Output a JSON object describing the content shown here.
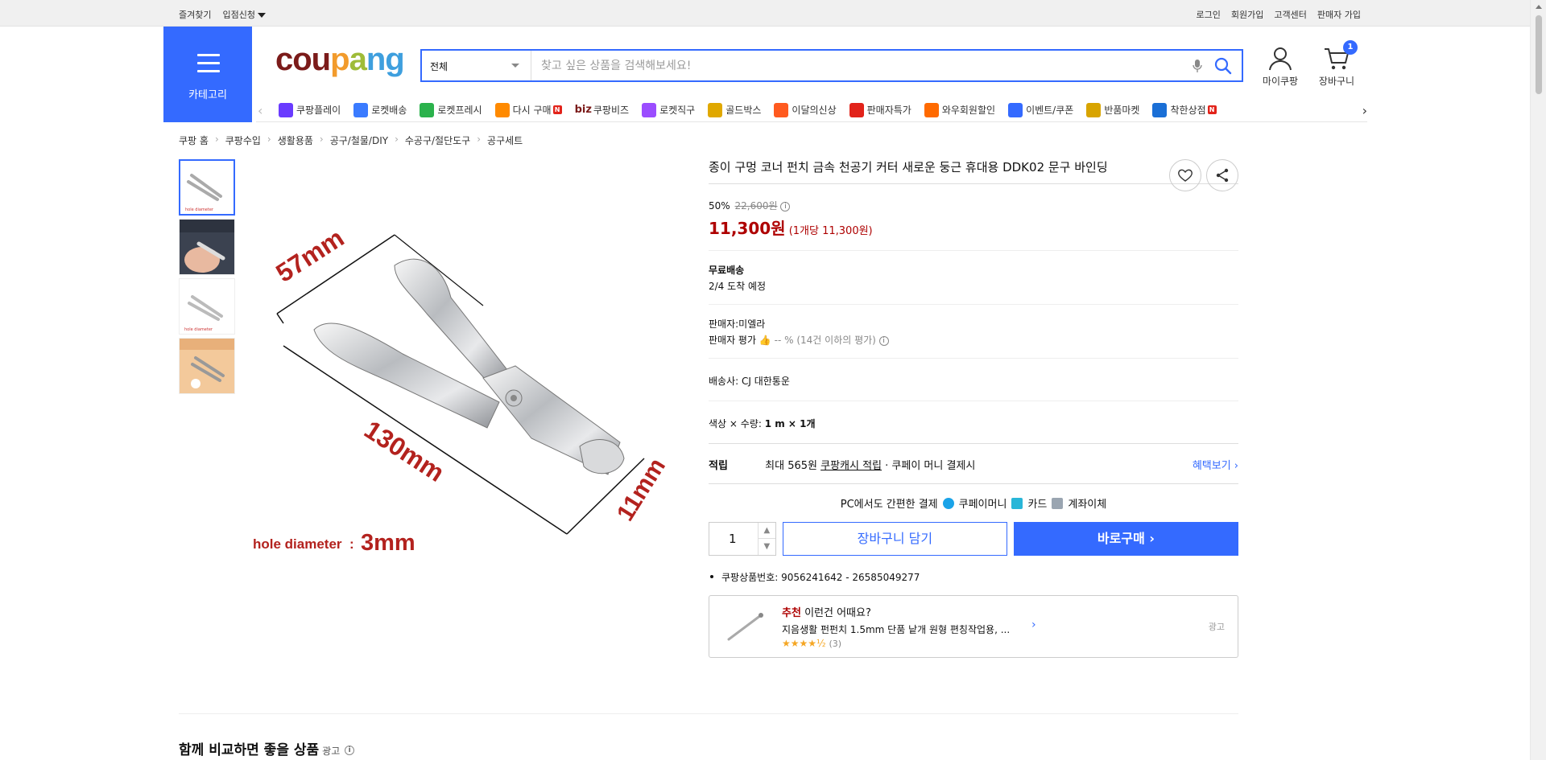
{
  "topbar": {
    "left": [
      "즐겨찾기",
      "입점신청"
    ],
    "right": [
      "로그인",
      "회원가입",
      "고객센터",
      "판매자 가입"
    ]
  },
  "header": {
    "category_label": "카테고리",
    "logo": {
      "c1": "cou",
      "c2": "p",
      "c3": "a",
      "c4": "ng"
    },
    "search_scope": "전체",
    "search_placeholder": "찾고 싶은 상품을 검색해보세요!",
    "mypage_label": "마이쿠팡",
    "cart_label": "장바구니",
    "cart_count": "1"
  },
  "quicknav": [
    {
      "label": "쿠팡플레이",
      "color": "#6a3bff"
    },
    {
      "label": "로켓배송",
      "color": "#3a7bff"
    },
    {
      "label": "로켓프레시",
      "color": "#2bb24c"
    },
    {
      "label": "다시 구매",
      "color": "#ff8a00",
      "badge": "N"
    },
    {
      "label": "쿠팡비즈",
      "prefix": "biz"
    },
    {
      "label": "로켓직구",
      "color": "#9b4dff"
    },
    {
      "label": "골드박스",
      "color": "#e0a800"
    },
    {
      "label": "이달의신상",
      "color": "#ff5a1f"
    },
    {
      "label": "판매자특가",
      "color": "#e2231a"
    },
    {
      "label": "와우회원할인",
      "color": "#ff6a00"
    },
    {
      "label": "이벤트/쿠폰",
      "color": "#346aff"
    },
    {
      "label": "반품마켓",
      "color": "#d8a400"
    },
    {
      "label": "착한상점",
      "color": "#1a6fd6",
      "badge": "N"
    }
  ],
  "breadcrumb": [
    "쿠팡 홈",
    "쿠팡수입",
    "생활용품",
    "공구/철물/DIY",
    "수공구/절단도구",
    "공구세트"
  ],
  "image_labels": {
    "len1": "57mm",
    "len2": "130mm",
    "len3": "11mm",
    "hole": "hole diameter",
    "hole_val": "3mm"
  },
  "product": {
    "title": "종이 구멍 코너 펀치 금속 천공기 커터 새로운 둥근 휴대용 DDK02 문구 바인딩",
    "discount": "50%",
    "original_price": "22,600원",
    "price": "11,300원",
    "unit_price": "(1개당 11,300원)",
    "shipping_title": "무료배송",
    "arrival": "2/4 도착 예정",
    "seller": "판매자:미엘라",
    "seller_rating_label": "판매자 평가",
    "seller_rating_value": "-- %",
    "seller_rating_note": "(14건 이하의 평가)",
    "carrier": "배송사:  CJ 대한통운",
    "option_label": "색상 × 수량:",
    "option_value": "1 m × 1개",
    "reward_label": "적립",
    "reward_pre": "최대 565원",
    "reward_link": "쿠팡캐시 적립",
    "reward_post": "· 쿠페이 머니 결제시",
    "reward_more": "혜택보기",
    "pay_title": "PC에서도 간편한 결제",
    "pay_options": [
      "쿠페이머니",
      "카드",
      "계좌이체"
    ],
    "quantity": "1",
    "add_cart": "장바구니 담기",
    "buy_now": "바로구매",
    "product_id": "쿠팡상품번호: 9056241642 - 26585049277"
  },
  "recommend": {
    "tag": "추천",
    "headline": "이런건 어때요?",
    "item": "지음생활 펀펀치 1.5mm 단품 낱개 원형 편칭작업용, ...",
    "stars": "★★★★½",
    "count": "(3)",
    "ad": "광고"
  },
  "compare": {
    "title": "함께 비교하면 좋을 상품",
    "ad": "광고"
  }
}
